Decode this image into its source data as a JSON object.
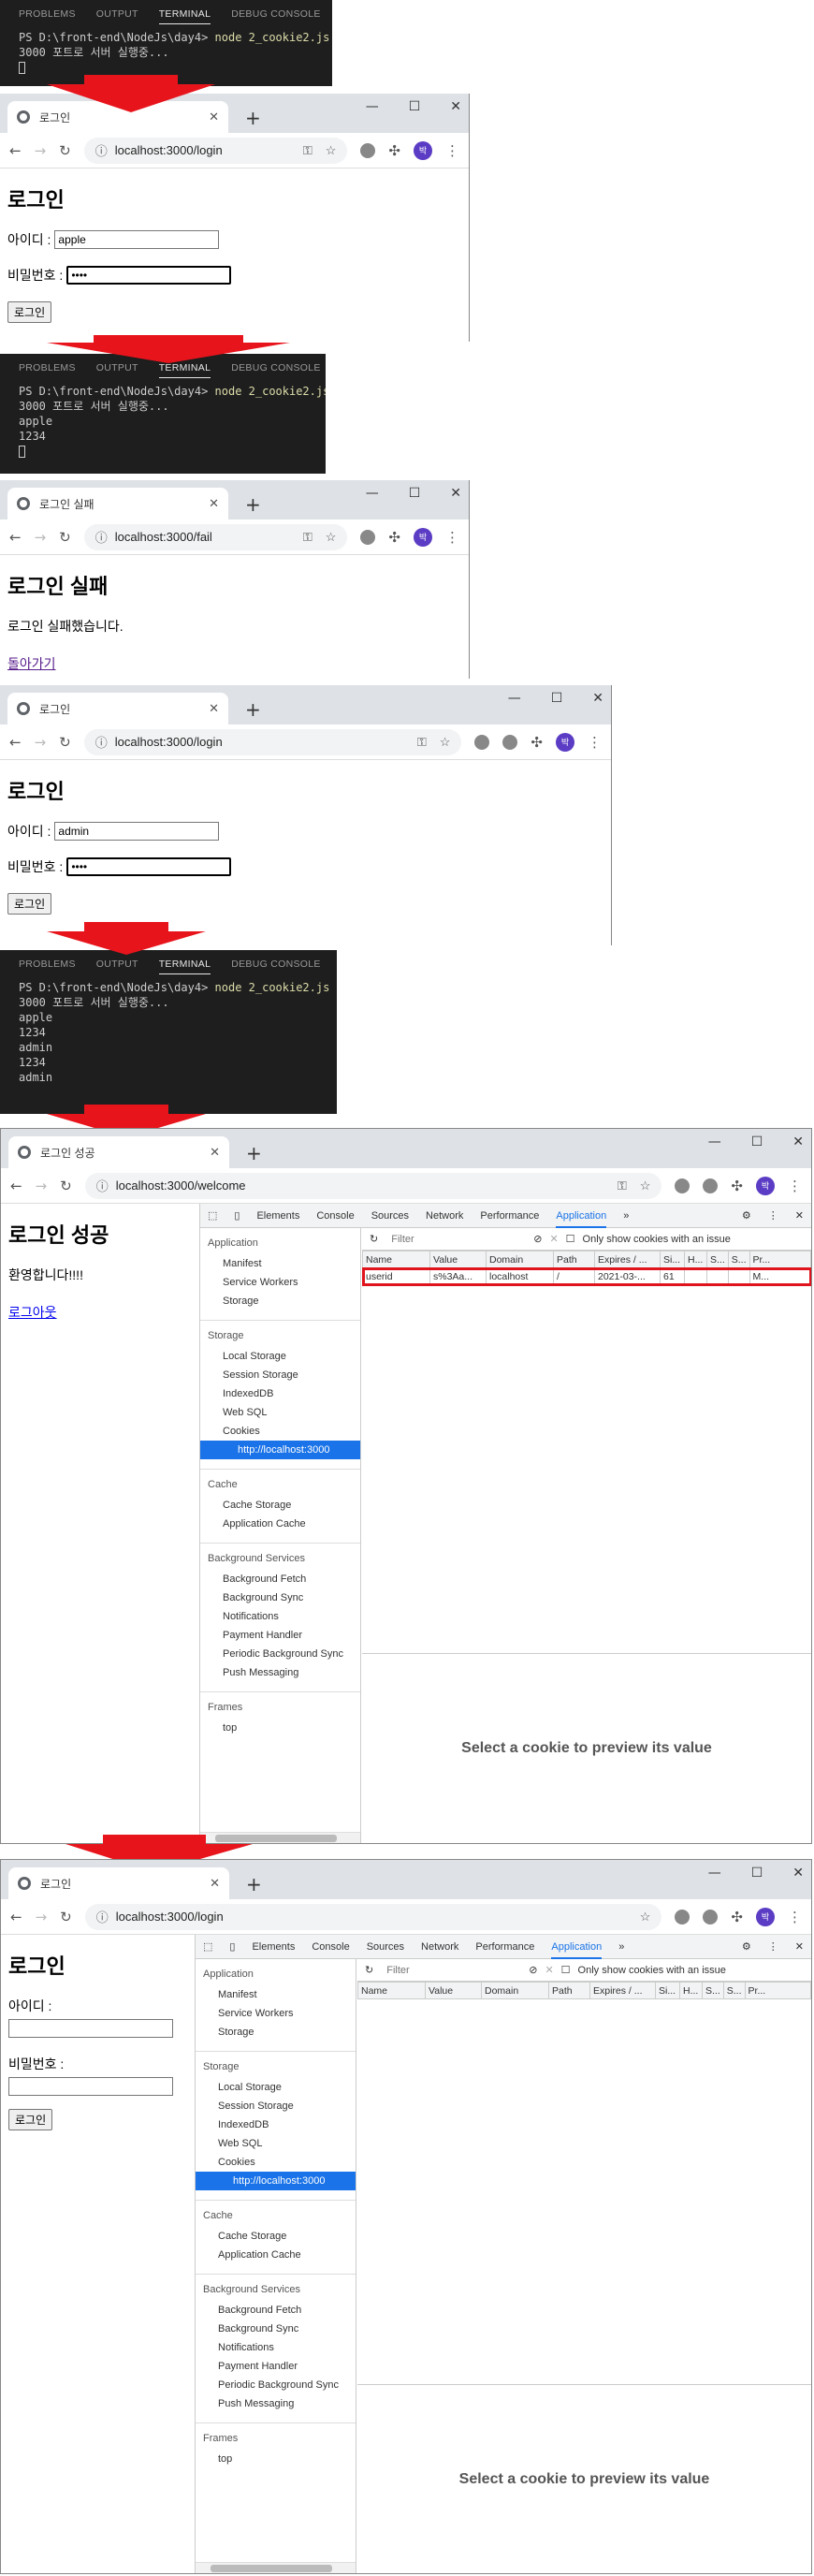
{
  "terminal_tabs": [
    "PROBLEMS",
    "OUTPUT",
    "TERMINAL",
    "DEBUG CONSOLE"
  ],
  "terminal_active": "TERMINAL",
  "terminal1": {
    "prompt": "PS D:\\front-end\\NodeJs\\day4> ",
    "cmd": "node 2_cookie2.js",
    "lines": [
      "3000 포트로 서버 실행중..."
    ]
  },
  "terminal2": {
    "prompt": "PS D:\\front-end\\NodeJs\\day4> ",
    "cmd": "node 2_cookie2.js",
    "lines": [
      "3000 포트로 서버 실행중...",
      "apple",
      "1234"
    ]
  },
  "terminal3": {
    "prompt": "PS D:\\front-end\\NodeJs\\day4> ",
    "cmd": "node 2_cookie2.js",
    "lines": [
      "3000 포트로 서버 실행중...",
      "apple",
      "1234",
      "admin",
      "1234",
      "admin"
    ]
  },
  "browser1": {
    "tab_title": "로그인",
    "url": "localhost:3000/login",
    "heading": "로그인",
    "id_label": "아이디 :",
    "id_value": "apple",
    "pw_label": "비밀번호 :",
    "pw_value": "••••",
    "button": "로그인"
  },
  "browser2": {
    "tab_title": "로그인 실패",
    "url": "localhost:3000/fail",
    "heading": "로그인 실패",
    "message": "로그인 실패했습니다.",
    "link": "돌아가기"
  },
  "browser3": {
    "tab_title": "로그인",
    "url": "localhost:3000/login",
    "heading": "로그인",
    "id_label": "아이디 :",
    "id_value": "admin",
    "pw_label": "비밀번호 :",
    "pw_value": "••••",
    "button": "로그인"
  },
  "browser4": {
    "tab_title": "로그인 성공",
    "url": "localhost:3000/welcome",
    "heading": "로그인 성공",
    "message": "환영합니다!!!!",
    "link": "로그아웃",
    "cookie_row": [
      "userid",
      "s%3Aa...",
      "localhost",
      "/",
      "2021-03-...",
      "61",
      "",
      "",
      "",
      "M..."
    ]
  },
  "browser5": {
    "tab_title": "로그인",
    "url": "localhost:3000/login",
    "heading": "로그인",
    "id_label": "아이디 :",
    "pw_label": "비밀번호 :",
    "button": "로그인"
  },
  "devtools": {
    "tabs": [
      "Elements",
      "Console",
      "Sources",
      "Network",
      "Performance",
      "Application",
      "»"
    ],
    "active_tab": "Application",
    "filter_placeholder": "Filter",
    "only_issue": "Only show cookies with an issue",
    "columns": [
      "Name",
      "Value",
      "Domain",
      "Path",
      "Expires / ...",
      "Si...",
      "H...",
      "S...",
      "S...",
      "Pr..."
    ],
    "preview": "Select a cookie to preview its value",
    "sections": [
      {
        "title": "Application",
        "items": [
          "Manifest",
          "Service Workers",
          "Storage"
        ]
      },
      {
        "title": "Storage",
        "items": [
          "Local Storage",
          "Session Storage",
          "IndexedDB",
          "Web SQL",
          "Cookies",
          "http://localhost:3000"
        ]
      },
      {
        "title": "Cache",
        "items": [
          "Cache Storage",
          "Application Cache"
        ]
      },
      {
        "title": "Background Services",
        "items": [
          "Background Fetch",
          "Background Sync",
          "Notifications",
          "Payment Handler",
          "Periodic Background Sync",
          "Push Messaging"
        ]
      },
      {
        "title": "Frames",
        "items": [
          "top"
        ]
      }
    ]
  },
  "colors": {
    "terminal_bg": "#1e1e1e",
    "arrow": "#e8141c",
    "accent": "#1a73e8",
    "highlight": "#e0141c"
  }
}
